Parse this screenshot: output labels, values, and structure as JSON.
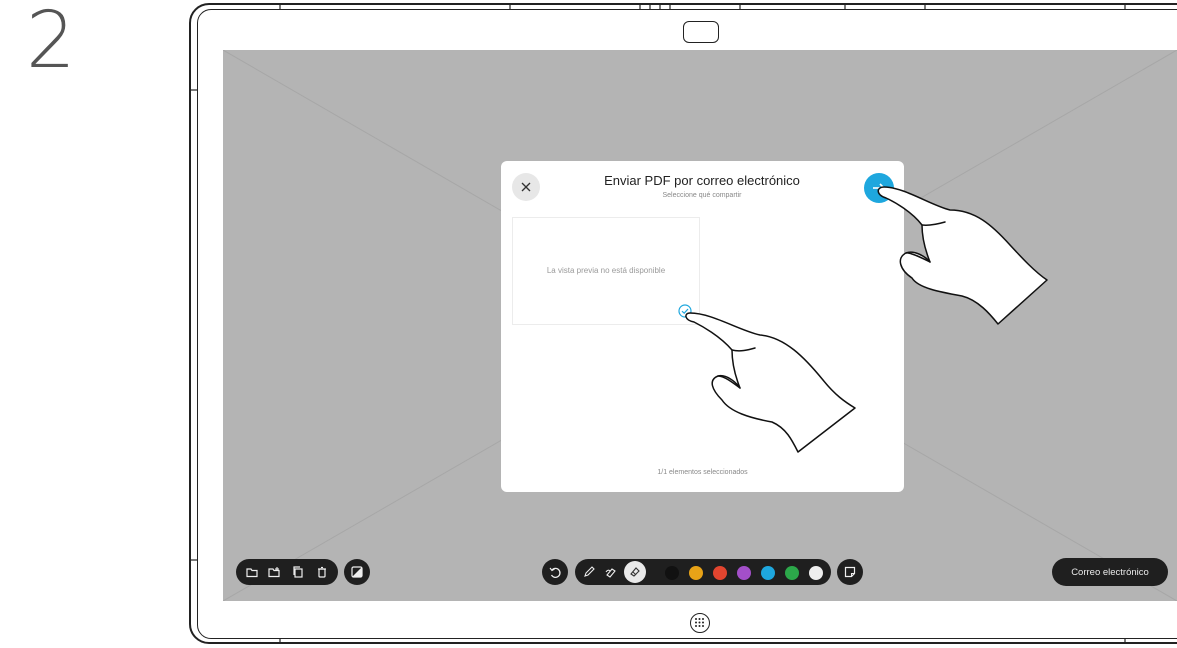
{
  "step": {
    "number": "2"
  },
  "dialog": {
    "title": "Enviar PDF por correo electrónico",
    "subtitle": "Seleccione qué compartir",
    "preview_unavailable": "La vista previa no está disponible",
    "selected_count": "1/1 elementos seleccionados",
    "close_icon": "close-icon",
    "send_icon": "arrow-right-icon"
  },
  "toolbar": {
    "left_icons": [
      "folder-open-icon",
      "new-page-icon",
      "copy-icon",
      "trash-icon"
    ],
    "right_icons": [
      "undo-icon",
      "pen-icon",
      "highlighter-icon",
      "eraser-icon",
      "sticky-note-icon"
    ],
    "colors": [
      "#111111",
      "#e8a317",
      "#e2452f",
      "#a34fc9",
      "#1ea7de",
      "#2ca84a",
      "#eeeeee"
    ],
    "email_button": "Correo electrónico"
  },
  "colors": {
    "accent": "#1ea7de",
    "screen_bg": "#b4b4b4",
    "toolbar_bg": "#1f1f1f"
  }
}
